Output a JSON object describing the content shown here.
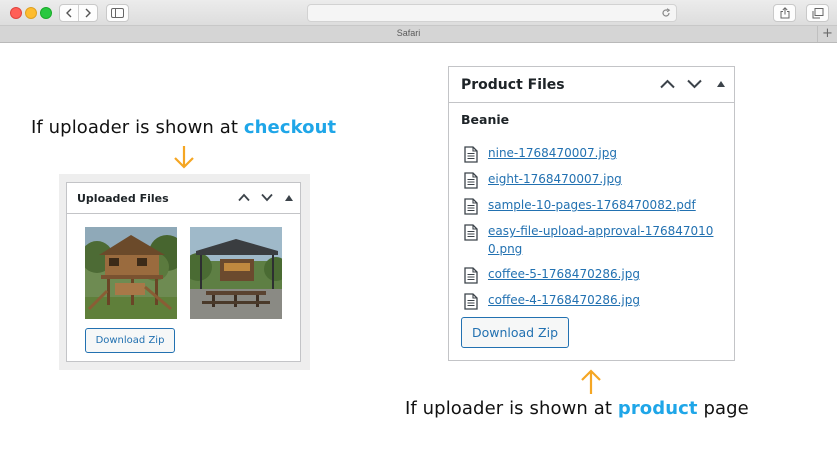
{
  "browser": {
    "tab_title": "Safari",
    "new_tab_label": "+"
  },
  "captions": {
    "checkout": {
      "prefix": "If uploader is shown at ",
      "highlight": "checkout",
      "suffix": ""
    },
    "product": {
      "prefix": "If uploader is shown at ",
      "highlight": "product",
      "suffix": " page"
    },
    "highlight_color": "#1fa6e8",
    "arrow_color": "#f5a623"
  },
  "checkout_box": {
    "title": "Uploaded Files",
    "images": [
      {
        "name": "wooden-treehouse-image"
      },
      {
        "name": "outdoor-cafe-image"
      }
    ],
    "download_label": "Download Zip"
  },
  "product_box": {
    "title": "Product Files",
    "product_name": "Beanie",
    "files": [
      "nine-1768470007.jpg",
      "eight-1768470007.jpg",
      "sample-10-pages-1768470082.pdf",
      "easy-file-upload-approval-1768470100.png",
      "coffee-5-1768470286.jpg",
      "coffee-4-1768470286.jpg"
    ],
    "download_label": "Download Zip"
  },
  "colors": {
    "link": "#2271b1",
    "border": "#c3c4c7"
  }
}
